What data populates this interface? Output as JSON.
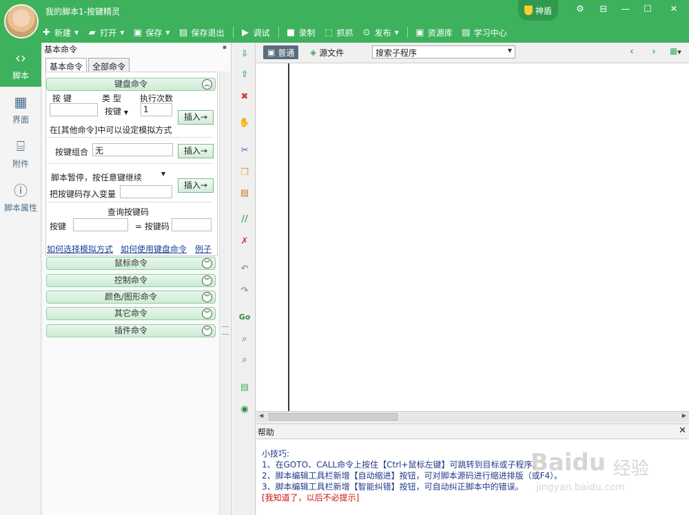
{
  "window": {
    "title": "我的脚本1-按键精灵",
    "shield_label": "神盾",
    "controls": [
      "⚙",
      "⊟",
      "—",
      "☐",
      "✕"
    ]
  },
  "toolbar": [
    {
      "label": "新建",
      "icon": "plus-icon",
      "glyph": "✚",
      "dropdown": true
    },
    {
      "label": "打开",
      "icon": "folder-icon",
      "glyph": "📂",
      "dropdown": true
    },
    {
      "label": "保存",
      "icon": "save-icon",
      "glyph": "💾",
      "dropdown": true
    },
    {
      "label": "保存退出",
      "icon": "save-exit-icon",
      "glyph": "🖫",
      "dropdown": false
    },
    {
      "label": "调试",
      "icon": "play-icon",
      "glyph": "▶",
      "dropdown": false
    },
    {
      "label": "录制",
      "icon": "camera-icon",
      "glyph": "■",
      "dropdown": false
    },
    {
      "label": "抓抓",
      "icon": "capture-icon",
      "glyph": "⬚",
      "dropdown": false
    },
    {
      "label": "发布",
      "icon": "publish-icon",
      "glyph": "⊙",
      "dropdown": true
    },
    {
      "label": "资源库",
      "icon": "library-icon",
      "glyph": "▣",
      "dropdown": false
    },
    {
      "label": "学习中心",
      "icon": "study-icon",
      "glyph": "▤",
      "dropdown": false
    }
  ],
  "leftnav": [
    {
      "label": "脚本",
      "icon": "script-icon",
      "glyph": "‹›",
      "active": true
    },
    {
      "label": "界面",
      "icon": "grid-icon",
      "glyph": "▦",
      "active": false
    },
    {
      "label": "附件",
      "icon": "attachment-icon",
      "glyph": "📎",
      "active": false
    },
    {
      "label": "脚本属性",
      "icon": "info-icon",
      "glyph": "ⓘ",
      "active": false
    }
  ],
  "panel": {
    "title": "基本命令",
    "tabs": [
      "基本命令",
      "全部命令"
    ],
    "keyboard": {
      "header": "键盘命令",
      "col_key": "按 键",
      "col_type": "类 型",
      "col_count": "执行次数",
      "type_value": "按键",
      "count_value": "1",
      "insert": "插入→",
      "note": "在[其他命令]中可以设定模拟方式",
      "combo_label": "按键组合",
      "combo_value": "无",
      "pause_label": "脚本暂停，按任意键继续",
      "store_label": "把按键码存入变量",
      "query_title": "查询按键码",
      "query_key": "按键",
      "query_code": "= 按键码"
    },
    "links": [
      "如何选择模拟方式",
      "如何使用键盘命令",
      "例子"
    ],
    "groups": [
      "鼠标命令",
      "控制命令",
      "颜色/图形命令",
      "其它命令",
      "插件命令"
    ]
  },
  "editor": {
    "tab_normal": "普通",
    "tab_source": "源文件",
    "subroutine_search": "搜索子程序"
  },
  "help": {
    "title": "帮助",
    "lines": [
      "小技巧:",
      "1、在GOTO、CALL命令上按住【Ctrl+鼠标左键】可跳转到目标或子程序。",
      "2、脚本编辑工具栏新增【自动缩进】按钮，可对脚本源码进行缩进排版（或F4）。",
      "3、脚本编辑工具栏新增【智能纠错】按钮，可自动纠正脚本中的错误。"
    ],
    "dismiss": "[我知道了，以后不必提示]"
  },
  "watermark": {
    "brand": "Baidu",
    "cn": "经验",
    "url": "jingyan.baidu.com"
  },
  "colors": {
    "accent": "#3db15c",
    "link": "#1a3f99",
    "warn": "#cc1111"
  }
}
